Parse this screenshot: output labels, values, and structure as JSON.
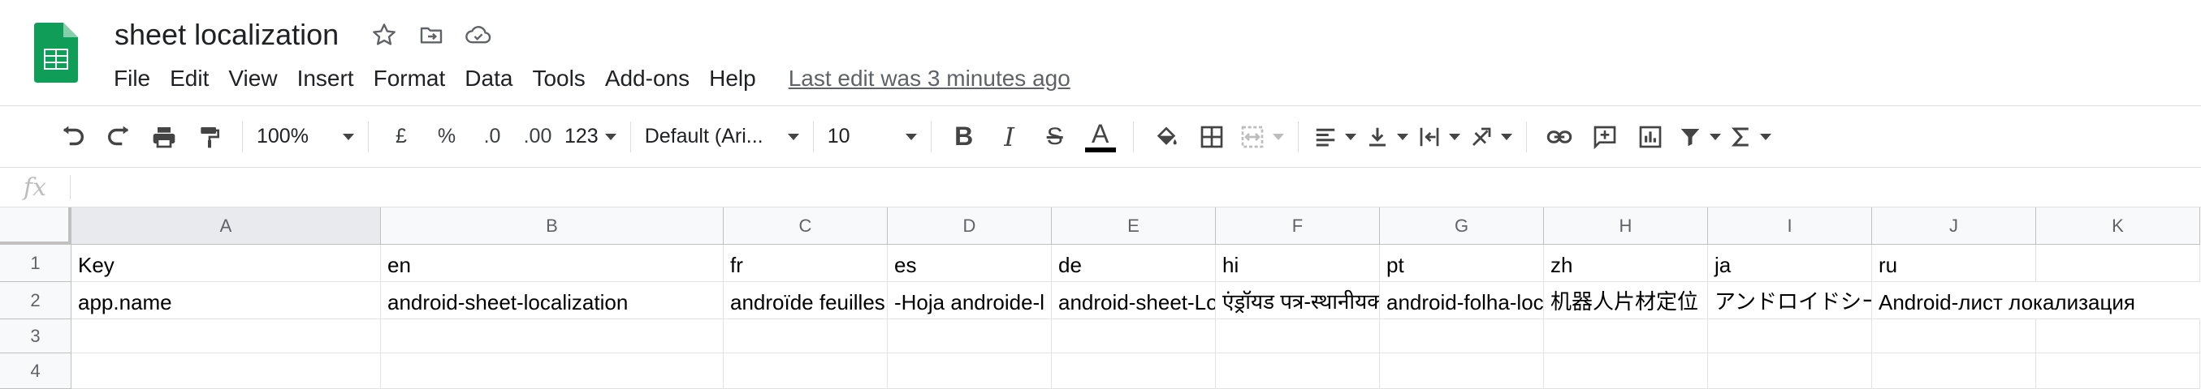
{
  "doc": {
    "title": "sheet localization",
    "logo": "google-sheets-logo",
    "icons": [
      "star-icon",
      "move-to-folder-icon",
      "cloud-status-icon"
    ]
  },
  "menu": {
    "items": [
      "File",
      "Edit",
      "View",
      "Insert",
      "Format",
      "Data",
      "Tools",
      "Add-ons",
      "Help"
    ],
    "last_edit": "Last edit was 3 minutes ago"
  },
  "toolbar": {
    "zoom": "100%",
    "currency": "£",
    "percent": "%",
    "decrease_decimal": ".0",
    "increase_decimal": ".00",
    "more_formats": "123",
    "font": "Default (Ari...",
    "font_size": "10",
    "bold": "B",
    "italic": "I",
    "strike": "S",
    "text_color": "A"
  },
  "formula": {
    "fx_label": "fx",
    "value": ""
  },
  "grid": {
    "columns": [
      "A",
      "B",
      "C",
      "D",
      "E",
      "F",
      "G",
      "H",
      "I",
      "J",
      "K"
    ],
    "row_numbers": [
      "1",
      "2",
      "3",
      "4"
    ],
    "rows": [
      [
        "Key",
        "en",
        "fr",
        "es",
        "de",
        "hi",
        "pt",
        "zh",
        "ja",
        "ru",
        ""
      ],
      [
        "app.name",
        "android-sheet-localization",
        "androïde feuilles",
        "-Hoja androide-l",
        "android-sheet-Lo",
        "एंड्रॉयड पत्र-स्थानीयक",
        "android-folha-loc",
        "机器人片材定位",
        "アンドロイドシー",
        "Android-лист локализация",
        ""
      ],
      [
        "",
        "",
        "",
        "",
        "",
        "",
        "",
        "",
        "",
        "",
        ""
      ],
      [
        "",
        "",
        "",
        "",
        "",
        "",
        "",
        "",
        "",
        "",
        ""
      ]
    ]
  },
  "colors": {
    "sheets_green": "#0f9d58",
    "header_bg": "#f8f9fa",
    "grid_line": "#e2e2e2",
    "selected_header": "#e8eaed"
  }
}
